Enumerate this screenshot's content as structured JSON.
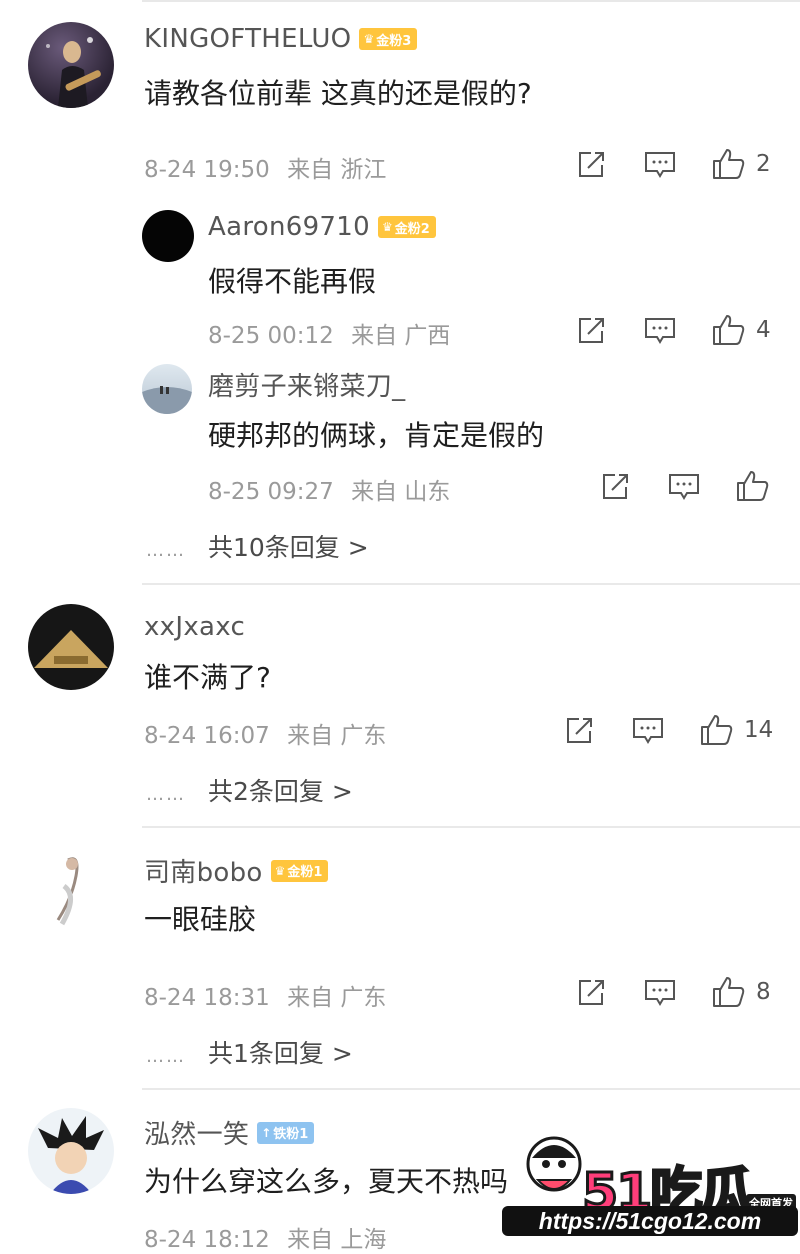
{
  "comments": [
    {
      "username": "KINGOFTHELUO",
      "badge": "金粉3",
      "text": "请教各位前辈 这真的还是假的?",
      "time": "8-24 19:50",
      "from": "来自 浙江",
      "likes": "2",
      "replies": [
        {
          "username": "Aaron69710",
          "badge": "金粉2",
          "text": "假得不能再假",
          "time": "8-25 00:12",
          "from": "来自 广西",
          "likes": "4"
        },
        {
          "username": "磨剪子来锵菜刀_",
          "text": "硬邦邦的俩球，肯定是假的",
          "time": "8-25 09:27",
          "from": "来自 山东",
          "likes": ""
        }
      ],
      "more_dots": "……",
      "more_label": "共10条回复 >"
    },
    {
      "username": "xxJxaxc",
      "text": "谁不满了?",
      "time": "8-24 16:07",
      "from": "来自 广东",
      "likes": "14",
      "more_dots": "……",
      "more_label": "共2条回复 >"
    },
    {
      "username": "司南bobo",
      "badge": "金粉1",
      "text": "一眼硅胶",
      "time": "8-24 18:31",
      "from": "来自 广东",
      "likes": "8",
      "more_dots": "……",
      "more_label": "共1条回复 >"
    },
    {
      "username": "泓然一笑",
      "badge": "铁粉1",
      "text": "为什么穿这么多，夏天不热吗",
      "time": "8-24 18:12",
      "from": "来自 上海"
    }
  ],
  "watermark": {
    "logo": "51吃瓜",
    "first": "全网首发",
    "url": "https://51cgo12.com"
  },
  "colors": {
    "gold_badge": "#ffc53d",
    "iron_badge": "#8ec3f0",
    "meta_text": "#9a9a9a"
  },
  "icons": [
    "share-icon",
    "comment-icon",
    "like-icon",
    "badge-icon"
  ]
}
